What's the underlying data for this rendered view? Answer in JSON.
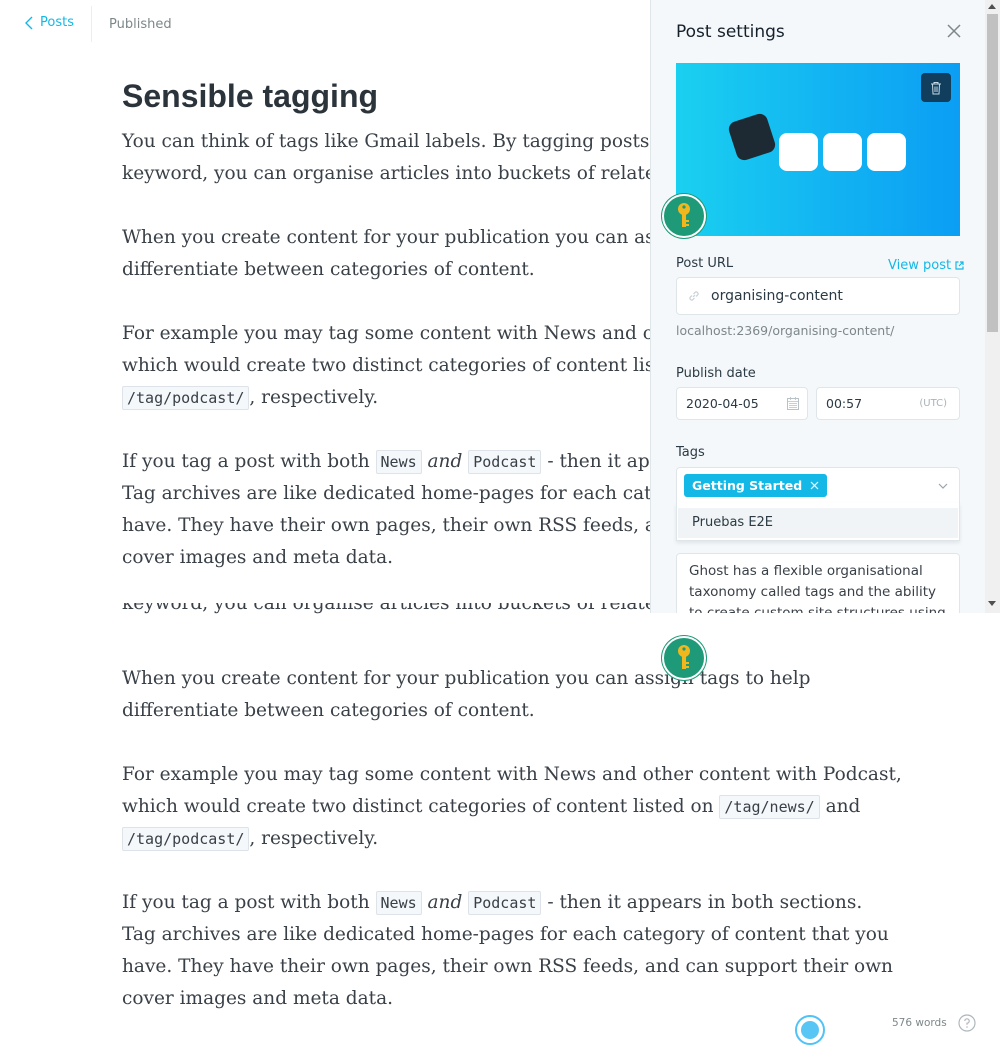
{
  "topbar": {
    "back_label": "Posts",
    "status": "Published"
  },
  "editor": {
    "title": "Sensible tagging",
    "p1_line1": "You can think of tags like Gmail labels. By tagging posts with one or more",
    "p1_line2": "keyword, you can organise articles into buckets of related content.",
    "p2_line1_a": "When you create content for your publication you can assign",
    "p2_line1_b": "tags",
    "p2_line1_c": "to help",
    "p2_line2": "differentiate between categories of content.",
    "p3_line1": "For example you may tag some content with News and other content with Podcast,",
    "p3_line2_a": "which would create two distinct categories of content listed on",
    "p3_code_news": "/tag/news/",
    "p3_line2_b": "and",
    "p3_code_podcast": "/tag/podcast/",
    "p3_line3_b": ", respectively.",
    "p4_a": "If you tag a post with both",
    "p4_code_news": "News",
    "p4_and": "and",
    "p4_code_podcast": "Podcast",
    "p4_b": "- then it appears in both sections.",
    "p4_line2": "Tag archives are like dedicated home-pages for each category of content that you",
    "p4_line3": "have. They have their own pages, their own RSS feeds, and can support their own",
    "p4_line4": "cover images and meta data."
  },
  "panel": {
    "title": "Post settings",
    "post_url_label": "Post URL",
    "view_post": "View post",
    "url_value": "organising-content",
    "url_hint": "localhost:2369/organising-content/",
    "publish_date_label": "Publish date",
    "date_value": "2020-04-05",
    "time_value": "00:57",
    "timezone": "(UTC)",
    "tags_label": "Tags",
    "selected_tag": "Getting Started",
    "dropdown_option": "Pruebas E2E",
    "excerpt": "Ghost has a flexible organisational taxonomy called tags and the ability to create custom site structures using"
  },
  "footer": {
    "word_count": "576 words"
  },
  "colors": {
    "accent": "#14b8e6",
    "key_bubble": "#1e9a78",
    "key_yellow": "#f2b71d",
    "trash_bg": "#103e5c"
  },
  "icons": {
    "back": "chevron-left-icon",
    "close": "close-icon",
    "trash": "trash-icon",
    "link": "link-icon",
    "calendar": "calendar-icon",
    "external": "external-link-icon",
    "remove_tag": "close-small-icon",
    "caret": "chevron-down-icon",
    "help": "help-icon",
    "key": "key-icon"
  }
}
